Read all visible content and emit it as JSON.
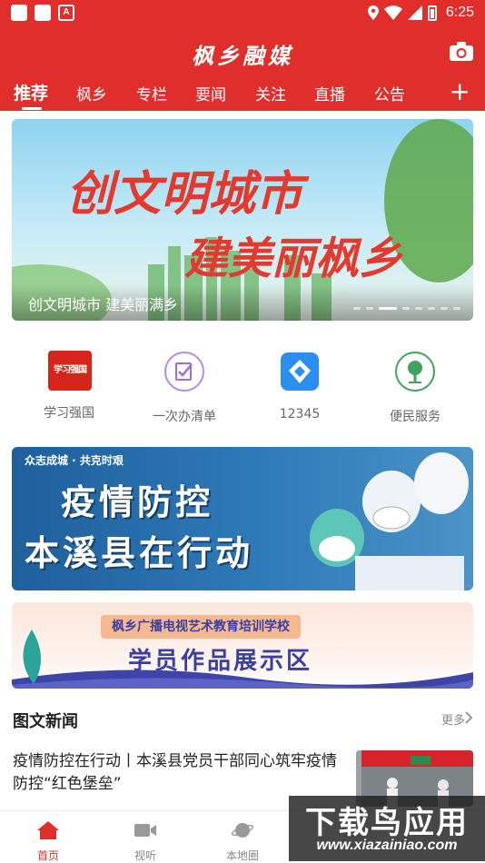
{
  "status_bar": {
    "time": "6:25"
  },
  "header": {
    "app_title": "枫乡融媒",
    "tabs": [
      {
        "label": "推荐",
        "active": true
      },
      {
        "label": "枫乡",
        "active": false
      },
      {
        "label": "专栏",
        "active": false
      },
      {
        "label": "要闻",
        "active": false
      },
      {
        "label": "关注",
        "active": false
      },
      {
        "label": "直播",
        "active": false
      },
      {
        "label": "公告",
        "active": false
      }
    ],
    "add_icon": "plus-icon",
    "camera_icon": "camera-icon"
  },
  "banner": {
    "caption": "创文明城市 建美丽满乡",
    "art_line1": "创文明城市",
    "art_line2": "建美丽枫乡",
    "dots_count": 8,
    "active_dot": 2
  },
  "quick_links": [
    {
      "label": "学习强国",
      "icon": "xuexi-qiangguo-icon",
      "logo_text": "学习强国"
    },
    {
      "label": "一次办清单",
      "icon": "checklist-icon"
    },
    {
      "label": "12345",
      "icon": "hotline-icon"
    },
    {
      "label": "便民服务",
      "icon": "tree-icon"
    }
  ],
  "promo_epidemic": {
    "top_text": "众志成城 · 共克时艰",
    "line1": "疫情防控",
    "line2": "本溪县在行动"
  },
  "promo_school": {
    "banner_text": "枫乡广播电视艺术教育培训学校",
    "title": "学员作品展示区"
  },
  "news_section": {
    "title": "图文新闻",
    "more_label": "更多",
    "items": [
      {
        "title": "疫情防控在行动丨本溪县党员干部同心筑牢疫情防控“红色堡垒”"
      }
    ]
  },
  "bottom_nav": [
    {
      "label": "首页",
      "icon": "home-icon",
      "active": true
    },
    {
      "label": "视听",
      "icon": "video-icon",
      "active": false
    },
    {
      "label": "本地圈",
      "icon": "planet-icon",
      "active": false
    }
  ],
  "watermark": {
    "title": "下载鸟应用",
    "url": "www.xiazainiao.com"
  },
  "colors": {
    "brand_red": "#e02f2a",
    "text_gray": "#666666"
  }
}
